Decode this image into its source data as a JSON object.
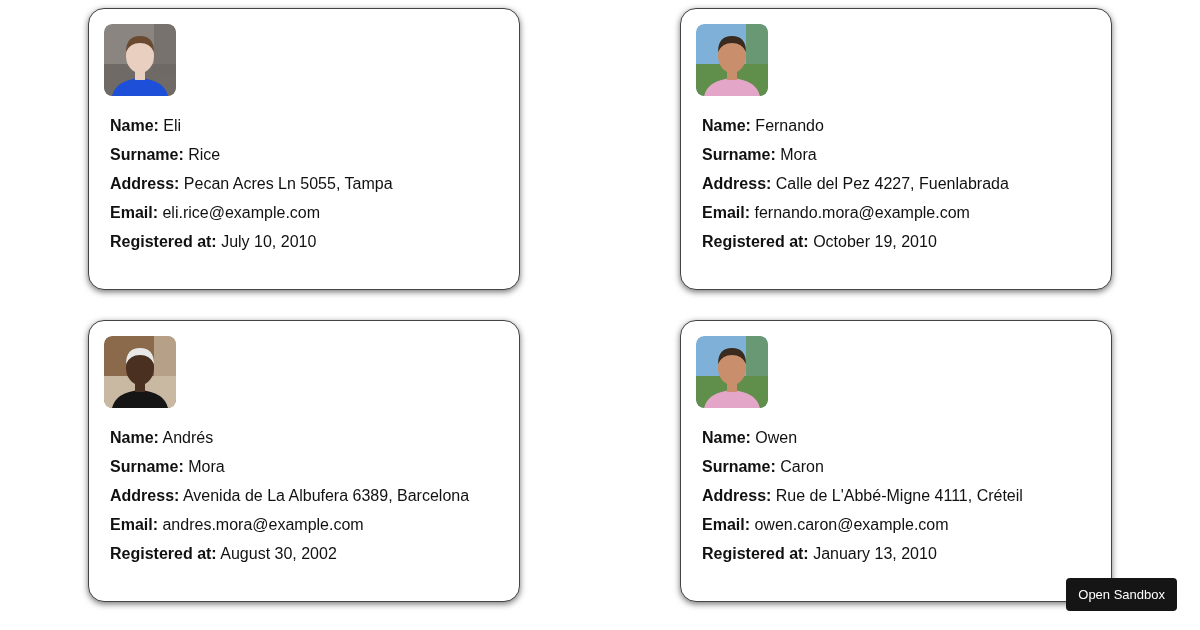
{
  "cards": [
    {
      "lines": [
        "**Name:** Eli",
        "**Surname:** Rice",
        "**Address:** Pecan Acres Ln 5055, Tampa",
        "**Email:** eli.rice@example.com",
        "**Registered at:** July 10, 2010"
      ]
    },
    {
      "lines": [
        "**Name:** Fernando",
        "**Surname:** Mora",
        "**Address:** Calle del Pez 4227, Fuenlabrada",
        "**Email:** fernando.mora@example.com",
        "**Registered at:** October 19, 2010"
      ]
    },
    {
      "lines": [
        "**Name:** Andrés",
        "**Surname:** Mora",
        "**Address:** Avenida de La Albufera 6389, Barcelona",
        "**Email:** andres.mora@example.com",
        "**Registered at:** August 30, 2002"
      ]
    },
    {
      "lines": [
        "**Name:** Owen",
        "**Surname:** Caron",
        "**Address:** Rue de L'Abbé-Migne 4111, Créteil",
        "**Email:** owen.caron@example.com",
        "**Registered at:** January 13, 2010"
      ]
    }
  ],
  "sandbox_button": "Open Sandbox"
}
